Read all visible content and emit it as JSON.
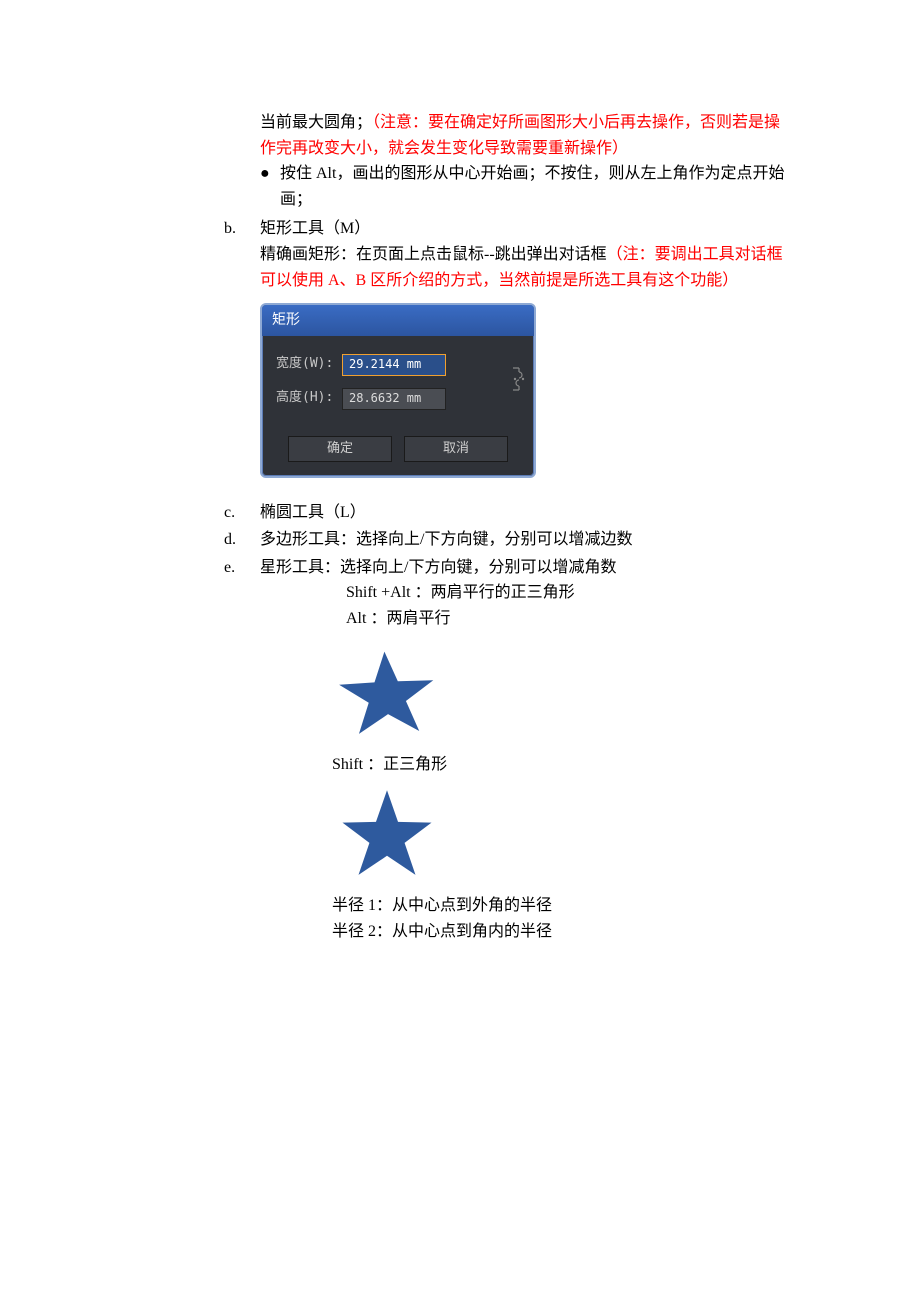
{
  "content": {
    "line1a": "当前最大圆角；",
    "line1b_red": "（注意：要在确定好所画图形大小后再去操作，否则若是操作完再改变大小，就会发生变化导致需要重新操作）",
    "bullet1": "按住 Alt，画出的图形从中心开始画；不按住，则从左上角作为定点开始画；",
    "item_b_label": "b.",
    "item_b_title": "矩形工具（M）",
    "item_b_body1": "精确画矩形：在页面上点击鼠标--跳出弹出对话框",
    "item_b_body1_red": "（注：要调出工具对话框可以使用 A、B 区所介绍的方式，当然前提是所选工具有这个功能）",
    "item_c_label": "c.",
    "item_c_text": "椭圆工具（L）",
    "item_d_label": "d.",
    "item_d_text": "多边形工具：选择向上/下方向键，分别可以增减边数",
    "item_e_label": "e.",
    "item_e_text": "星形工具：选择向上/下方向键，分别可以增减角数",
    "shift_alt": "Shift +Alt ：两肩平行的正三角形",
    "alt_only": "Alt ：两肩平行",
    "shift_only": "Shift ：正三角形",
    "radius1": "半径 1：从中心点到外角的半径",
    "radius2": "半径 2：从中心点到角内的半径"
  },
  "dialog": {
    "title": "矩形",
    "width_label": "宽度(W):",
    "width_value": "29.2144 mm",
    "height_label": "高度(H):",
    "height_value": "28.6632 mm",
    "ok": "确定",
    "cancel": "取消"
  },
  "star_color": "#2e5a9e"
}
